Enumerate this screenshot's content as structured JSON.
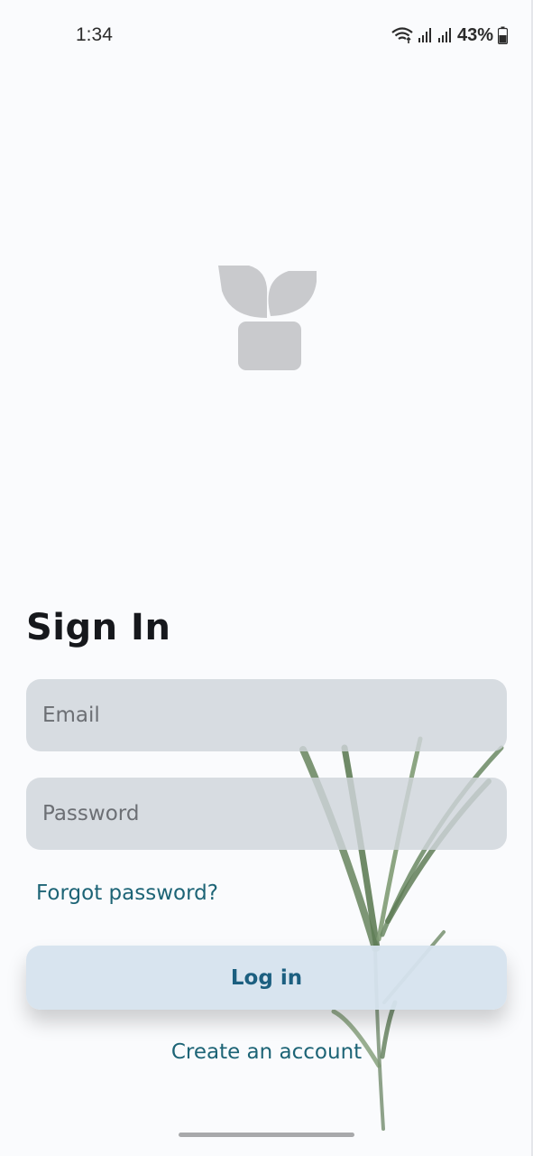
{
  "status_bar": {
    "time": "1:34",
    "battery": "43%",
    "icons": [
      "wifi-icon",
      "signal-icon",
      "signal-icon",
      "battery-icon"
    ]
  },
  "logo": {
    "icon": "plant-pot-icon",
    "color": "#c9cacd"
  },
  "signin": {
    "title": "Sign In",
    "email_placeholder": "Email",
    "email_value": "",
    "password_placeholder": "Password",
    "password_value": "",
    "forgot_label": "Forgot password?",
    "login_label": "Log in",
    "create_label": "Create an account"
  },
  "colors": {
    "background": "#fafbfd",
    "accent": "#1d6476",
    "button_bg": "#d6e3ee",
    "input_bg": "#d0d4da"
  }
}
